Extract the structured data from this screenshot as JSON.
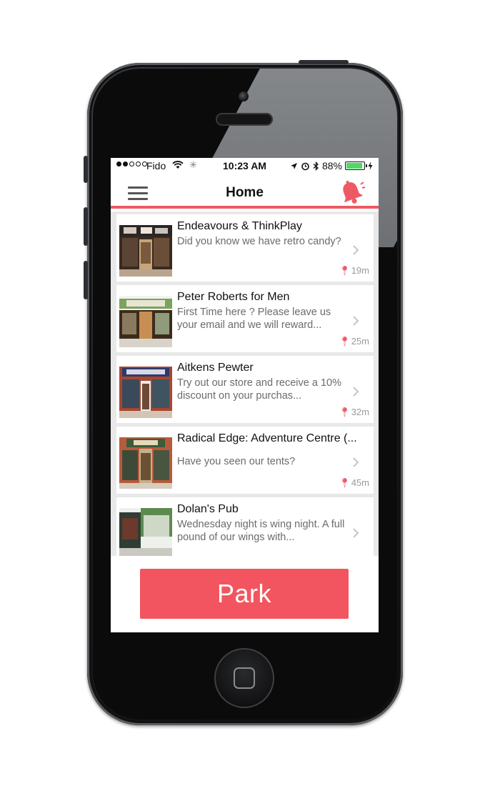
{
  "colors": {
    "accent": "#ee5a64",
    "park": "#f2555f",
    "battery": "#4cd964"
  },
  "status_bar": {
    "carrier": "Fido",
    "time": "10:23 AM",
    "battery": "88%",
    "signal_bars_filled": 2,
    "signal_bars_total": 5
  },
  "nav": {
    "title": "Home",
    "menu_icon": "hamburger-menu-icon",
    "bell_icon": "bell-icon"
  },
  "places": [
    {
      "name": "Endeavours & ThinkPlay",
      "desc": "Did you know we have retro candy?",
      "distance": "19m"
    },
    {
      "name": "Peter Roberts for Men",
      "desc": "First Time here ? Please leave us your email and we will reward...",
      "distance": "25m"
    },
    {
      "name": "Aitkens Pewter",
      "desc": "Try out our store and receive a 10% discount on your purchas...",
      "distance": "32m"
    },
    {
      "name": "Radical Edge: Adventure Centre (...",
      "desc": "Have you seen our tents?",
      "distance": "45m"
    },
    {
      "name": "Dolan's Pub",
      "desc": "Wednesday night is wing night. A full pound of our wings with...",
      "distance": ""
    }
  ],
  "park_button": "Park"
}
